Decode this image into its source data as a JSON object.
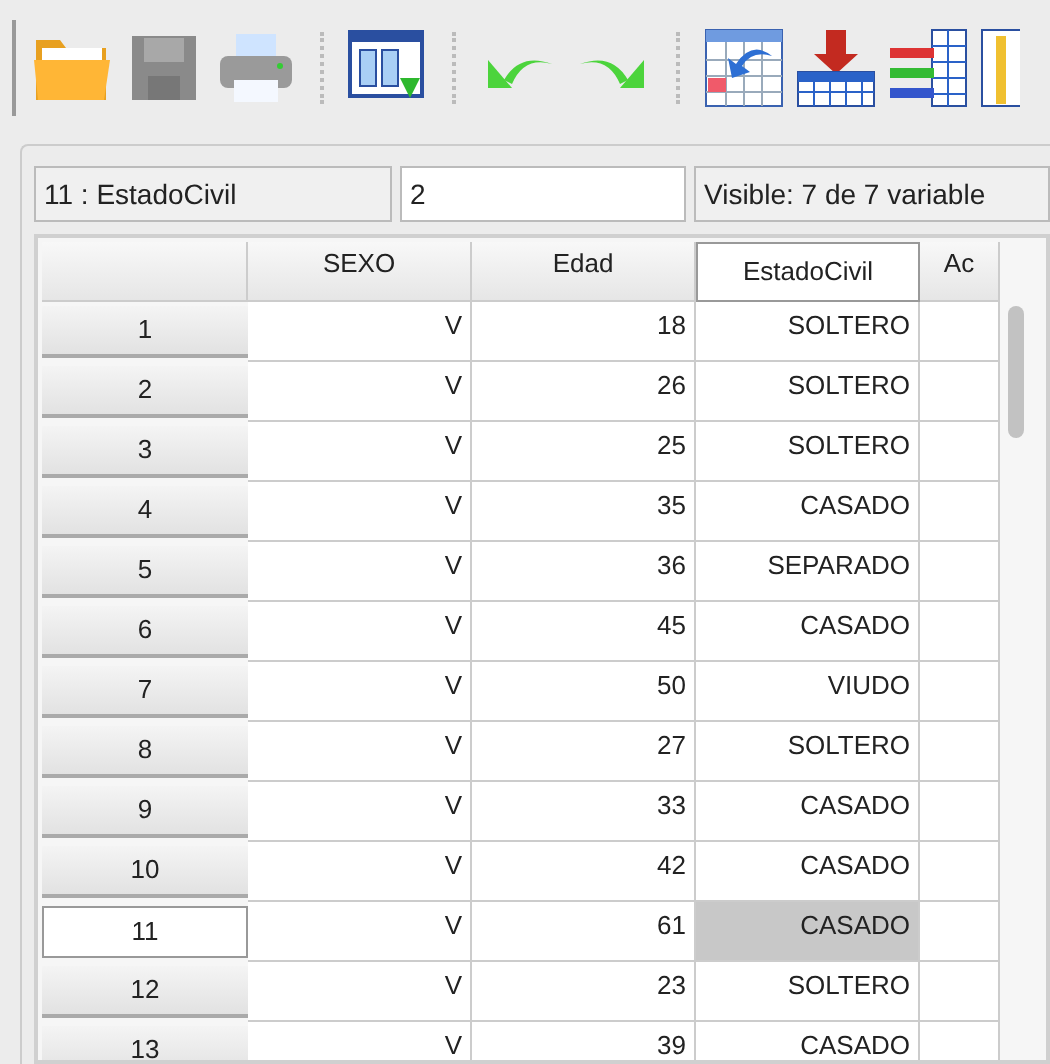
{
  "cell_info": {
    "location": "11 : EstadoCivil",
    "value": "2",
    "visible": "Visible: 7 de 7 variable"
  },
  "columns": [
    {
      "label": "SEXO",
      "selected": false
    },
    {
      "label": "Edad",
      "selected": false
    },
    {
      "label": "EstadoCivil",
      "selected": true
    },
    {
      "label": "Ac",
      "selected": false
    }
  ],
  "rows": [
    {
      "label": "1",
      "selected": false,
      "cells": [
        "V",
        "18",
        "SOLTERO"
      ]
    },
    {
      "label": "2",
      "selected": false,
      "cells": [
        "V",
        "26",
        "SOLTERO"
      ]
    },
    {
      "label": "3",
      "selected": false,
      "cells": [
        "V",
        "25",
        "SOLTERO"
      ]
    },
    {
      "label": "4",
      "selected": false,
      "cells": [
        "V",
        "35",
        "CASADO"
      ]
    },
    {
      "label": "5",
      "selected": false,
      "cells": [
        "V",
        "36",
        "SEPARADO"
      ]
    },
    {
      "label": "6",
      "selected": false,
      "cells": [
        "V",
        "45",
        "CASADO"
      ]
    },
    {
      "label": "7",
      "selected": false,
      "cells": [
        "V",
        "50",
        "VIUDO"
      ]
    },
    {
      "label": "8",
      "selected": false,
      "cells": [
        "V",
        "27",
        "SOLTERO"
      ]
    },
    {
      "label": "9",
      "selected": false,
      "cells": [
        "V",
        "33",
        "CASADO"
      ]
    },
    {
      "label": "10",
      "selected": false,
      "cells": [
        "V",
        "42",
        "CASADO"
      ]
    },
    {
      "label": "11",
      "selected": true,
      "cells": [
        "V",
        "61",
        "CASADO"
      ]
    },
    {
      "label": "12",
      "selected": false,
      "cells": [
        "V",
        "23",
        "SOLTERO"
      ]
    },
    {
      "label": "13",
      "selected": false,
      "cells": [
        "V",
        "39",
        "CASADO"
      ]
    }
  ]
}
